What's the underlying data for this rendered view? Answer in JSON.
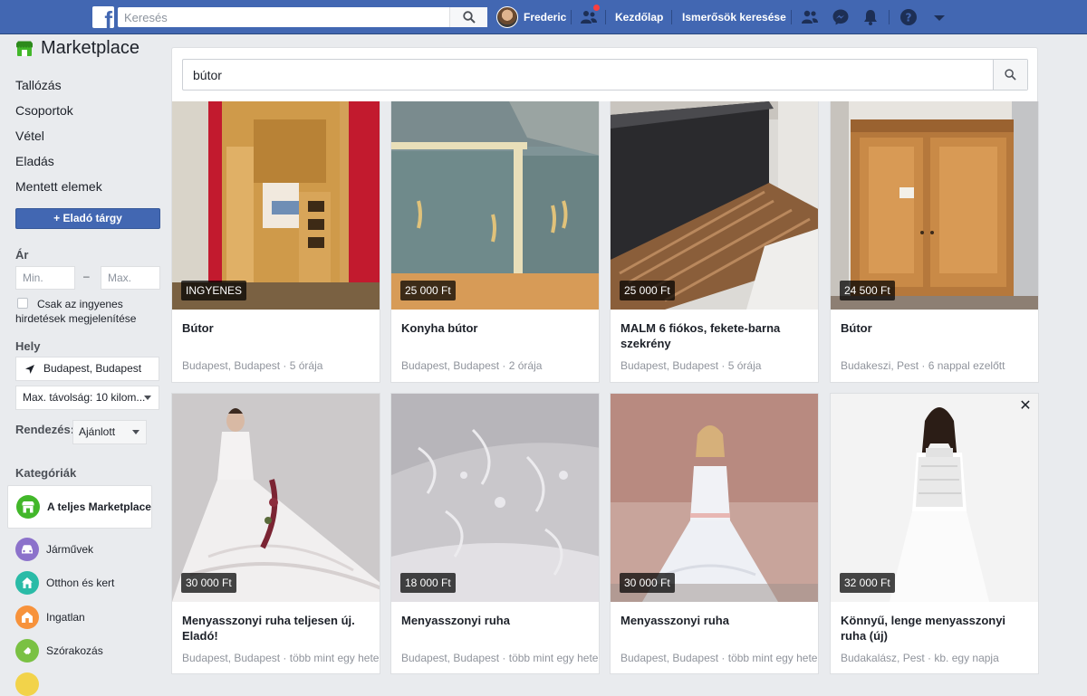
{
  "topbar": {
    "search_placeholder": "Keresés",
    "profile_name": "Frederic",
    "home_link": "Kezdőlap",
    "find_friends_link": "Ismerősök keresése"
  },
  "sidebar": {
    "title": "Marketplace",
    "links": [
      "Tallózás",
      "Csoportok",
      "Vétel",
      "Eladás",
      "Mentett elemek"
    ],
    "sell_button": "+ Eladó tárgy",
    "price_label": "Ár",
    "min_placeholder": "Min.",
    "max_placeholder": "Max.",
    "dash": "–",
    "free_only_label": "Csak az ingyenes hirdetések megjelenítése",
    "location_label": "Hely",
    "location_value": "Budapest, Budapest",
    "distance_value": "Max. távolság: 10 kilom...",
    "sort_label": "Rendezés:",
    "sort_value": "Ajánlott",
    "categories_label": "Kategóriák",
    "categories": [
      {
        "label": "A teljes Marketplace",
        "icon": "store-icon",
        "color": "#42b72a"
      },
      {
        "label": "Járművek",
        "icon": "car-icon",
        "color": "#8c72cb"
      },
      {
        "label": "Otthon és kert",
        "icon": "home-icon",
        "color": "#2abba7"
      },
      {
        "label": "Ingatlan",
        "icon": "house-icon",
        "color": "#f7923b"
      },
      {
        "label": "Szórakozás",
        "icon": "ticket-icon",
        "color": "#7ac143"
      }
    ]
  },
  "main": {
    "search_query": "bútor"
  },
  "listings": [
    {
      "price": "INGYENES",
      "title": "Bútor",
      "meta": "Budapest, Budapest · 5 órája"
    },
    {
      "price": "25 000 Ft",
      "title": "Konyha bútor",
      "meta": "Budapest, Budapest · 2 órája"
    },
    {
      "price": "25 000 Ft",
      "title": "MALM 6 fiókos, fekete-barna szekrény",
      "meta": "Budapest, Budapest · 5 órája"
    },
    {
      "price": "24 500 Ft",
      "title": "Bútor",
      "meta": "Budakeszi, Pest · 6 nappal ezelőtt"
    },
    {
      "price": "30 000 Ft",
      "title": "Menyasszonyi ruha teljesen új. Eladó!",
      "meta": "Budapest, Budapest · több mint egy hete"
    },
    {
      "price": "18 000 Ft",
      "title": "Menyasszonyi ruha",
      "meta": "Budapest, Budapest · több mint egy hete"
    },
    {
      "price": "30 000 Ft",
      "title": "Menyasszonyi ruha",
      "meta": "Budapest, Budapest · több mint egy hete"
    },
    {
      "price": "32 000 Ft",
      "title": "Könnyű, lenge menyasszonyi ruha (új)",
      "meta": "Budakalász, Pest · kb. egy napja"
    }
  ]
}
